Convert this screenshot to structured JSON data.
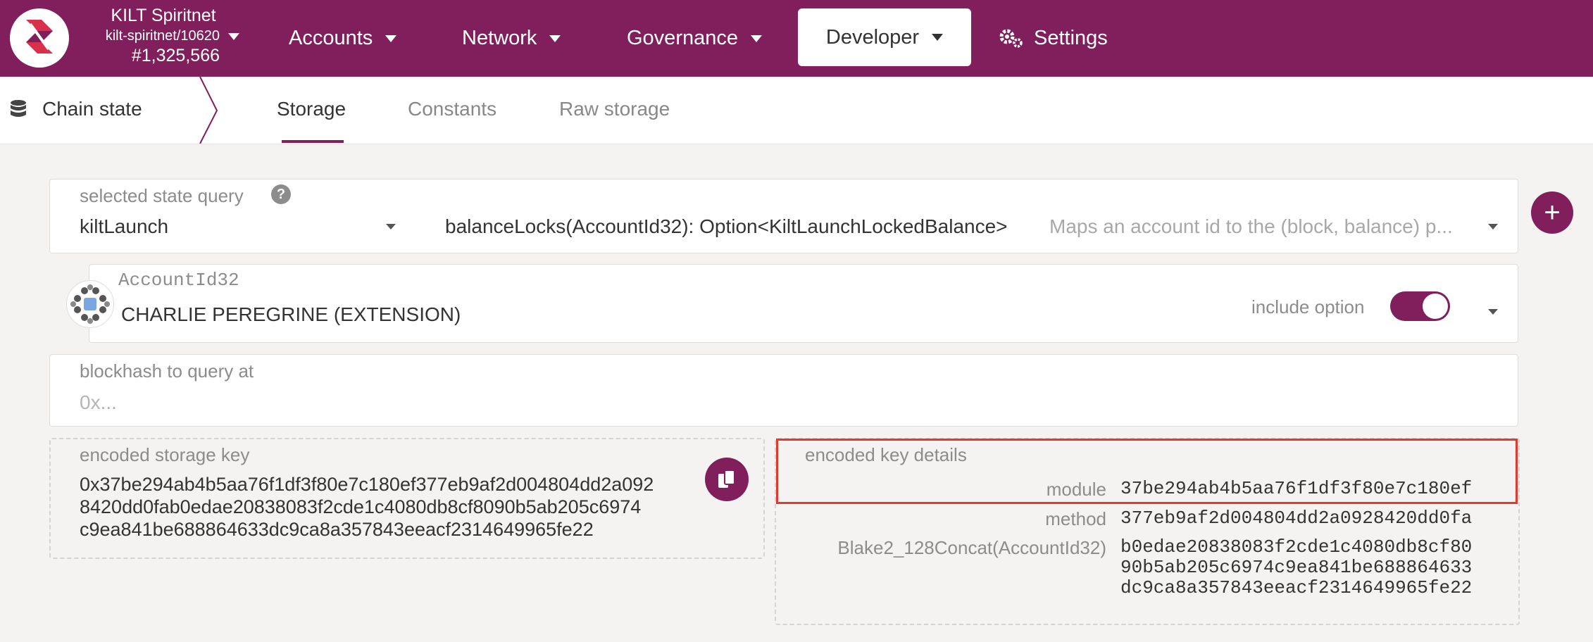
{
  "topbar": {
    "chain_name": "KILT Spiritnet",
    "chain_spec": "kilt-spiritnet/10620",
    "block_number": "#1,325,566",
    "nav": {
      "accounts": "Accounts",
      "network": "Network",
      "governance": "Governance",
      "developer": "Developer",
      "settings": "Settings"
    },
    "brand_color": "#801f5c"
  },
  "subnav": {
    "section": "Chain state",
    "tabs": [
      "Storage",
      "Constants",
      "Raw storage"
    ],
    "active_tab": "Storage"
  },
  "query": {
    "label": "selected state query",
    "help_icon": "?",
    "module": "kiltLaunch",
    "method": "balanceLocks(AccountId32): Option<KiltLaunchLockedBalance>",
    "method_description": "Maps an account id to the (block, balance) p..."
  },
  "account": {
    "label": "AccountId32",
    "value": "CHARLIE PEREGRINE (EXTENSION)",
    "include_option_label": "include option",
    "include_option": true
  },
  "blockhash": {
    "label": "blockhash to query at",
    "placeholder": "0x..."
  },
  "encoded_key": {
    "label": "encoded storage key",
    "lines": [
      "0x37be294ab4b5aa76f1df3f80e7c180ef377eb9af2d004804dd2a092",
      "8420dd0fab0edae20838083f2cde1c4080db8cf8090b5ab205c6974",
      "c9ea841be688864633dc9ca8a357843eeacf2314649965fe22"
    ]
  },
  "key_details": {
    "label": "encoded key details",
    "rows": [
      {
        "name": "module",
        "value": [
          "37be294ab4b5aa76f1df3f80e7c180ef"
        ]
      },
      {
        "name": "method",
        "value": [
          "377eb9af2d004804dd2a0928420dd0fa"
        ]
      },
      {
        "name": "Blake2_128Concat(AccountId32)",
        "value": [
          "b0edae20838083f2cde1c4080db8cf80",
          "90b5ab205c6974c9ea841be688864633",
          "dc9ca8a357843eeacf2314649965fe22"
        ]
      }
    ]
  }
}
